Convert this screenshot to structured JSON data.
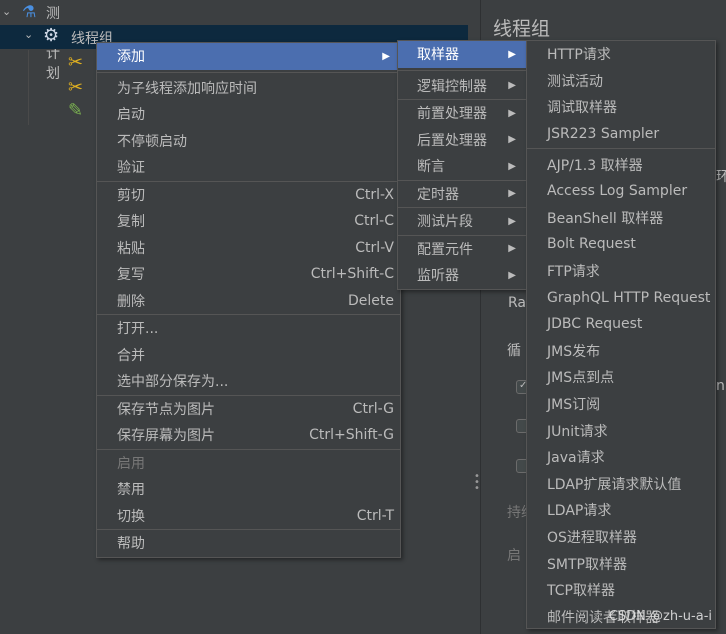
{
  "tree": {
    "root": "测试计划",
    "thread_group": "线程组"
  },
  "right_panel": {
    "title": "线程组",
    "frag_ra": "Ra",
    "frag_loop": "循",
    "frag_duration": "持续",
    "frag_start": "启",
    "frag_right1": "环",
    "frag_right2": "n"
  },
  "context_menu": {
    "items": [
      {
        "label": "添加",
        "shortcut": ""
      },
      {
        "label": "为子线程添加响应时间",
        "shortcut": ""
      },
      {
        "label": "启动",
        "shortcut": ""
      },
      {
        "label": "不停顿启动",
        "shortcut": ""
      },
      {
        "label": "验证",
        "shortcut": ""
      },
      {
        "label": "剪切",
        "shortcut": "Ctrl-X"
      },
      {
        "label": "复制",
        "shortcut": "Ctrl-C"
      },
      {
        "label": "粘贴",
        "shortcut": "Ctrl-V"
      },
      {
        "label": "复写",
        "shortcut": "Ctrl+Shift-C"
      },
      {
        "label": "删除",
        "shortcut": "Delete"
      },
      {
        "label": "打开...",
        "shortcut": ""
      },
      {
        "label": "合并",
        "shortcut": ""
      },
      {
        "label": "选中部分保存为...",
        "shortcut": ""
      },
      {
        "label": "保存节点为图片",
        "shortcut": "Ctrl-G"
      },
      {
        "label": "保存屏幕为图片",
        "shortcut": "Ctrl+Shift-G"
      },
      {
        "label": "启用",
        "shortcut": ""
      },
      {
        "label": "禁用",
        "shortcut": ""
      },
      {
        "label": "切换",
        "shortcut": "Ctrl-T"
      },
      {
        "label": "帮助",
        "shortcut": ""
      }
    ]
  },
  "add_submenu": {
    "items": [
      "取样器",
      "逻辑控制器",
      "前置处理器",
      "后置处理器",
      "断言",
      "定时器",
      "测试片段",
      "配置元件",
      "监听器"
    ]
  },
  "sampler_submenu": {
    "items": [
      "HTTP请求",
      "测试活动",
      "调试取样器",
      "JSR223 Sampler",
      "AJP/1.3 取样器",
      "Access Log Sampler",
      "BeanShell 取样器",
      "Bolt Request",
      "FTP请求",
      "GraphQL HTTP Request",
      "JDBC Request",
      "JMS发布",
      "JMS点到点",
      "JMS订阅",
      "JUnit请求",
      "Java请求",
      "LDAP扩展请求默认值",
      "LDAP请求",
      "OS进程取样器",
      "SMTP取样器",
      "TCP取样器",
      "邮件阅读者取样器"
    ]
  },
  "watermark": "CSDN @zh-u-a-i",
  "colors": {
    "background": "#3c3f41",
    "highlight": "#4b6eaf",
    "tree_selection": "#0d293e"
  }
}
